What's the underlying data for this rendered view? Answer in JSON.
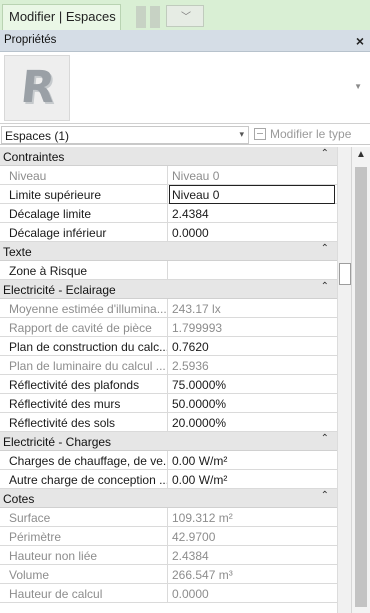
{
  "ribbon": {
    "tab_label": "Modifier | Espaces"
  },
  "panel": {
    "title": "Propriétés",
    "close_label": "×"
  },
  "type_selector": {
    "logo_letter": "R"
  },
  "instance_selector": {
    "value": "Espaces (1)",
    "edit_type_label": "Modifier le type"
  },
  "groups": [
    {
      "label": "Contraintes",
      "rows": [
        {
          "label": "Niveau",
          "value": "Niveau 0",
          "readonly": true
        },
        {
          "label": "Limite supérieure",
          "value": "Niveau 0",
          "readonly": false
        },
        {
          "label": "Décalage limite",
          "value": "2.4384",
          "readonly": false
        },
        {
          "label": "Décalage inférieur",
          "value": "0.0000",
          "readonly": false
        }
      ]
    },
    {
      "label": "Texte",
      "rows": [
        {
          "label": "Zone à Risque",
          "value": "",
          "readonly": false
        }
      ]
    },
    {
      "label": "Electricité - Eclairage",
      "rows": [
        {
          "label": "Moyenne estimée d'illumina...",
          "value": "243.17 lx",
          "readonly": true
        },
        {
          "label": "Rapport de cavité de pièce",
          "value": "1.799993",
          "readonly": true
        },
        {
          "label": "Plan de construction du calc...",
          "value": "0.7620",
          "readonly": false
        },
        {
          "label": "Plan de luminaire du calcul ...",
          "value": "2.5936",
          "readonly": true
        },
        {
          "label": "Réflectivité des plafonds",
          "value": "75.0000%",
          "readonly": false
        },
        {
          "label": "Réflectivité des murs",
          "value": "50.0000%",
          "readonly": false
        },
        {
          "label": "Réflectivité des sols",
          "value": "20.0000%",
          "readonly": false
        }
      ]
    },
    {
      "label": "Electricité - Charges",
      "rows": [
        {
          "label": "Charges de chauffage, de ve...",
          "value": "0.00 W/m²",
          "readonly": false
        },
        {
          "label": "Autre charge de conception ...",
          "value": "0.00 W/m²",
          "readonly": false
        }
      ]
    },
    {
      "label": "Cotes",
      "rows": [
        {
          "label": "Surface",
          "value": "109.312 m²",
          "readonly": true
        },
        {
          "label": "Périmètre",
          "value": "42.9700",
          "readonly": true
        },
        {
          "label": "Hauteur non liée",
          "value": "2.4384",
          "readonly": true
        },
        {
          "label": "Volume",
          "value": "266.547 m³",
          "readonly": true
        },
        {
          "label": "Hauteur de calcul",
          "value": "0.0000",
          "readonly": true
        }
      ]
    }
  ],
  "icons": {
    "collapse": "chevron-double-up-icon",
    "dropdown": "chevron-down-icon",
    "close": "close-icon"
  }
}
